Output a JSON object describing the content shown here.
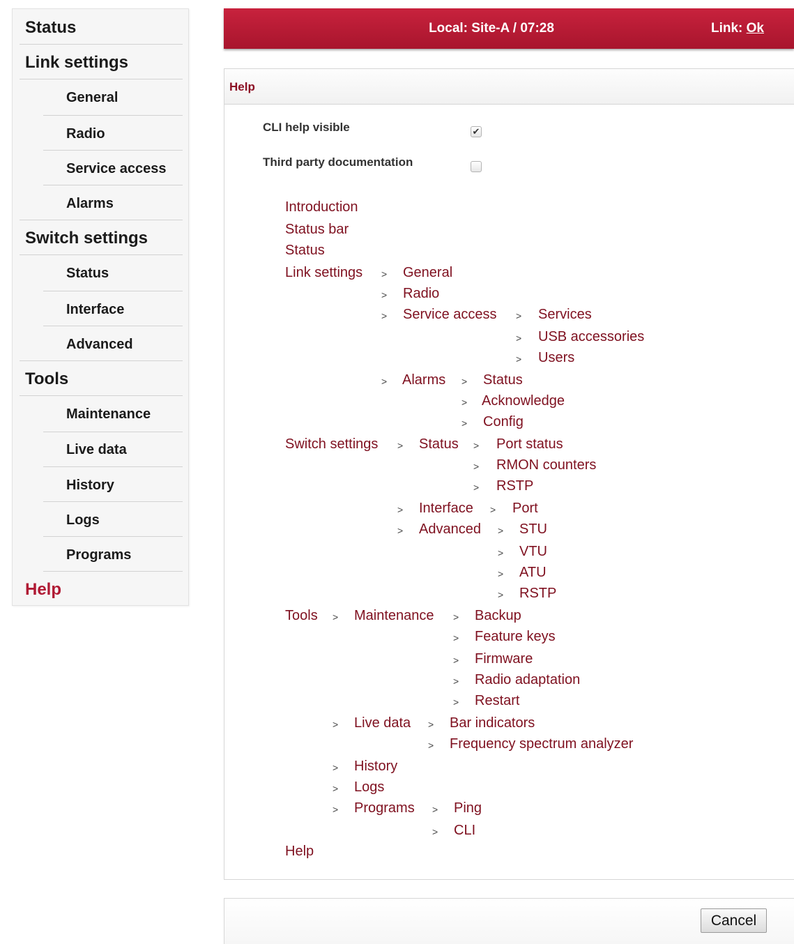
{
  "sidebar": {
    "items": [
      {
        "label": "Status",
        "level": "top"
      },
      {
        "label": "Link settings",
        "level": "top"
      },
      {
        "label": "General",
        "level": "sub"
      },
      {
        "label": "Radio",
        "level": "sub"
      },
      {
        "label": "Service access",
        "level": "sub"
      },
      {
        "label": "Alarms",
        "level": "sub"
      },
      {
        "label": "Switch settings",
        "level": "top"
      },
      {
        "label": "Status",
        "level": "sub"
      },
      {
        "label": "Interface",
        "level": "sub"
      },
      {
        "label": "Advanced",
        "level": "sub"
      },
      {
        "label": "Tools",
        "level": "top"
      },
      {
        "label": "Maintenance",
        "level": "sub"
      },
      {
        "label": "Live data",
        "level": "sub"
      },
      {
        "label": "History",
        "level": "sub"
      },
      {
        "label": "Logs",
        "level": "sub"
      },
      {
        "label": "Programs",
        "level": "sub"
      },
      {
        "label": "Help",
        "level": "top",
        "active": true
      }
    ]
  },
  "status_bar": {
    "local": "Local: Site-A / 07:28",
    "link_label": "Link:",
    "link_value": "Ok"
  },
  "help": {
    "title": "Help",
    "options": [
      {
        "label": "CLI help visible",
        "checked": true
      },
      {
        "label": "Third party documentation",
        "checked": false
      }
    ],
    "separator": ">",
    "toc": {
      "introduction": "Introduction",
      "status_bar": "Status bar",
      "status": "Status",
      "link_settings": "Link settings",
      "general": "General",
      "radio": "Radio",
      "service_access": "Service access",
      "services": "Services",
      "usb_accessories": "USB accessories",
      "users": "Users",
      "alarms": "Alarms",
      "alarms_status": "Status",
      "acknowledge": "Acknowledge",
      "config": "Config",
      "switch_settings": "Switch settings",
      "switch_status": "Status",
      "port_status": "Port status",
      "rmon_counters": "RMON counters",
      "rstp_status": "RSTP",
      "interface": "Interface",
      "port": "Port",
      "advanced": "Advanced",
      "stu": "STU",
      "vtu": "VTU",
      "atu": "ATU",
      "rstp_advanced": "RSTP",
      "tools": "Tools",
      "maintenance": "Maintenance",
      "backup": "Backup",
      "feature_keys": "Feature keys",
      "firmware": "Firmware",
      "radio_adaptation": "Radio adaptation",
      "restart": "Restart",
      "live_data": "Live data",
      "bar_indicators": "Bar indicators",
      "frequency_spectrum_analyzer": "Frequency spectrum analyzer",
      "history": "History",
      "logs": "Logs",
      "programs": "Programs",
      "ping": "Ping",
      "cli": "CLI",
      "help": "Help"
    }
  },
  "footer": {
    "cancel_label": "Cancel"
  },
  "colors": {
    "accent": "#b01a34",
    "link": "#7f1120"
  }
}
